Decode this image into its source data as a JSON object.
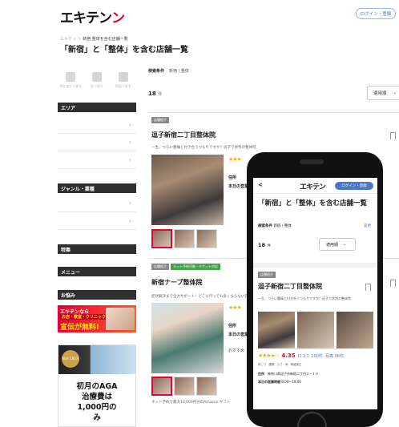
{
  "header": {
    "logo_text": "エキテン",
    "login_label": "ログイン・登録"
  },
  "breadcrumb": {
    "home": "エキテン",
    "sep": "＞",
    "current": "新宿 整体を含む店舗一覧"
  },
  "page_title": "「新宿」と「整体」を含む店舗一覧",
  "sidebar": {
    "quick_icons": [
      {
        "label": "現在地から探す",
        "icon": "location-person-icon"
      },
      {
        "label": "駅で探す",
        "icon": "station-icon"
      },
      {
        "label": "地図で探す",
        "icon": "map-icon"
      }
    ],
    "area_heading": "エリア",
    "genre_heading": "ジャンル・業種",
    "special_heading": "特集",
    "menu_heading": "メニュー",
    "concern_heading": "お悩み",
    "chevron": "›"
  },
  "banner_free": {
    "line1": "エキテンなら",
    "line2": "お店・教室・クリニックまで",
    "line3": "宣伝が無料!"
  },
  "banner_aga": {
    "badge": "AGA 185万",
    "text_lines": [
      "初月のAGA",
      "治療費は",
      "1,000円の",
      "み"
    ]
  },
  "search": {
    "condition_label": "検索条件",
    "condition_value": "新宿 / 整体",
    "count": "18",
    "count_unit": "件",
    "sort_label": "適用順"
  },
  "cards": [
    {
      "tag": "店舗紹介",
      "name": "逗子新宿二丁目整体院",
      "description": "一生、つらい腰痛と付き合うつもりですか？逗子で評判の整体院",
      "info_label": "住所",
      "hours_label": "本日の営業"
    },
    {
      "tag": "店舗紹介",
      "tag2": "ネット予約可能・チケット対応",
      "name": "新宿ナーブ整体院",
      "description": "症状解決まで全力サポート！どこに行っても良くならない方へ",
      "info_label": "住所",
      "hours_label": "本日の営業",
      "recommend_label": "おすすめ",
      "net_label": "ネット予約で最大10,000円分のAmazon ギフト"
    }
  ],
  "phone": {
    "logo_text": "エキテン",
    "login_label": "ログイン・登録",
    "back": "<",
    "title": "「新宿」と「整体」を含む店舗一覧",
    "condition_label": "検索条件",
    "condition_value": "新宿 / 整体",
    "change_label": "変更",
    "count": "18",
    "count_unit": "件",
    "sort_label": "適用順",
    "card_tag": "店舗紹介",
    "card_name": "逗子新宿二丁目整体院",
    "card_desc": "一生、つらい腰痛と付き合うつもりですか？逗子で評判の整体院",
    "rating": "4.35",
    "reviews": "口コミ 100件",
    "photos": "写真 36件",
    "tags": [
      "肩こり",
      "腰痛",
      "ひざ・肩",
      "骨盤矯正"
    ],
    "address_label": "住所",
    "address_value": "神奈川県逗子市新宿二丁目２−１０",
    "hours_label": "本日の営業時間",
    "hours_value": "8:00〜19:00"
  },
  "colors": {
    "brand_red": "#e6002d",
    "heading_dark": "#2f2f2f",
    "link_blue": "#4a78c8",
    "star": "#f0b400"
  }
}
